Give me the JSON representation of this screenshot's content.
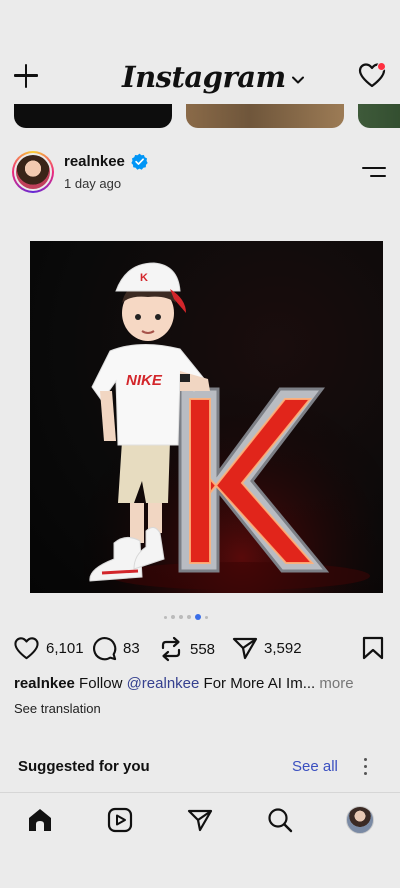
{
  "app": {
    "title": "Instagram"
  },
  "header": {
    "add_icon": "plus-icon",
    "brand_chevron_icon": "chevron-down-icon",
    "notifications_icon": "heart-icon",
    "notification_dot_color": "#ff3040"
  },
  "post": {
    "username": "realnkee",
    "verified": true,
    "timestamp": "1 day ago",
    "image_alt_icons": [
      "cartoon-boy",
      "letter-k-neon"
    ],
    "carousel": {
      "total": 5,
      "active_index": 4
    },
    "likes": "6,101",
    "comments": "83",
    "reposts": "558",
    "shares": "3,592",
    "caption": {
      "user": "realnkee",
      "text_before": " Follow ",
      "mention": "@realnkee",
      "text_after": " For More AI Im...",
      "more": " more"
    },
    "see_translation": "See translation"
  },
  "suggested": {
    "title": "Suggested for you",
    "see_all": "See all"
  },
  "nav": {
    "items": [
      "home-icon",
      "reels-icon",
      "direct-icon",
      "search-icon",
      "profile-avatar"
    ]
  },
  "colors": {
    "background": "#ebebeb",
    "link_blue": "#3a4fc0",
    "mention_blue": "#35408f",
    "verified_blue": "#0095f6",
    "carousel_active": "#3a6ee8"
  }
}
